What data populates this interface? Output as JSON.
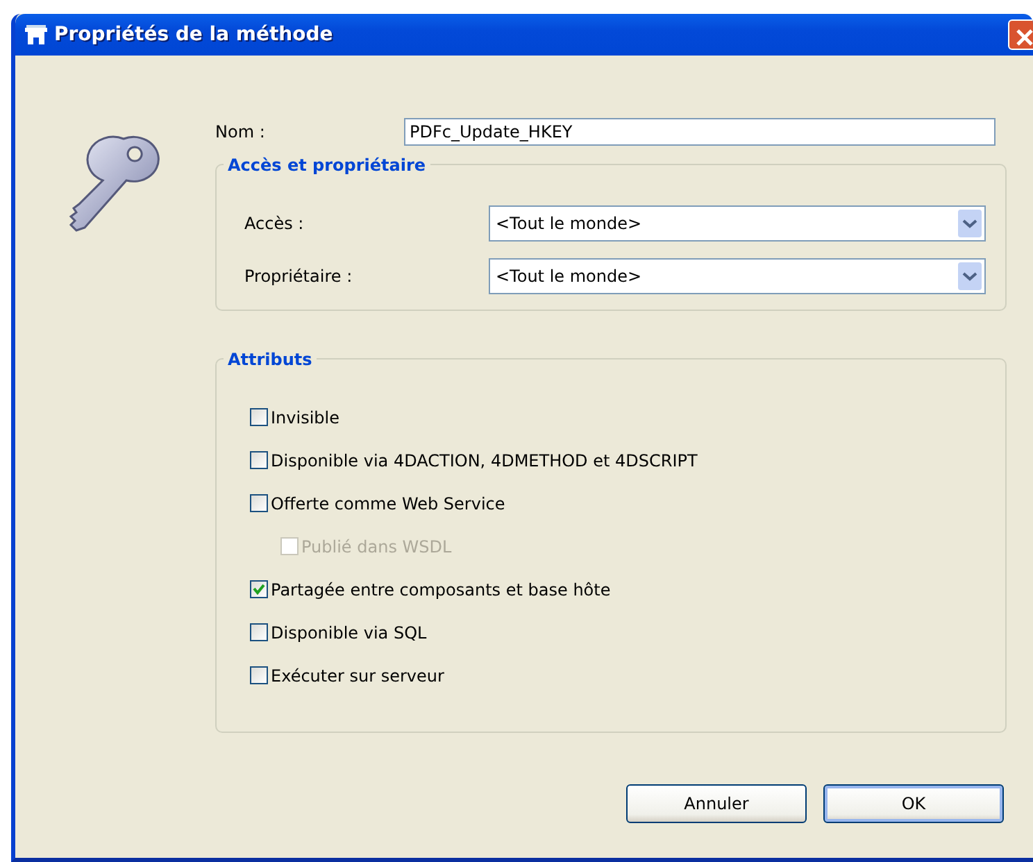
{
  "window": {
    "title": "Propriétés de la méthode"
  },
  "name_field": {
    "label": "Nom :",
    "value": "PDFc_Update_HKEY"
  },
  "access_group": {
    "title": "Accès et propriétaire",
    "fields": [
      {
        "label": "Accès :",
        "value": "<Tout le monde>"
      },
      {
        "label": "Propriétaire :",
        "value": "<Tout le monde>"
      }
    ]
  },
  "attributes_group": {
    "title": "Attributs",
    "items": [
      {
        "label": "Invisible",
        "checked": false,
        "disabled": false
      },
      {
        "label": "Disponible via 4DACTION, 4DMETHOD et 4DSCRIPT",
        "checked": false,
        "disabled": false
      },
      {
        "label": "Offerte comme Web Service",
        "checked": false,
        "disabled": false,
        "children": [
          {
            "label": "Publié dans WSDL",
            "checked": false,
            "disabled": true
          }
        ]
      },
      {
        "label": "Partagée entre composants et base hôte",
        "checked": true,
        "disabled": false
      },
      {
        "label": "Disponible via SQL",
        "checked": false,
        "disabled": false
      },
      {
        "label": "Exécuter sur serveur",
        "checked": false,
        "disabled": false
      }
    ]
  },
  "buttons": [
    {
      "label": "Annuler",
      "default": false
    },
    {
      "label": "OK",
      "default": true
    }
  ]
}
